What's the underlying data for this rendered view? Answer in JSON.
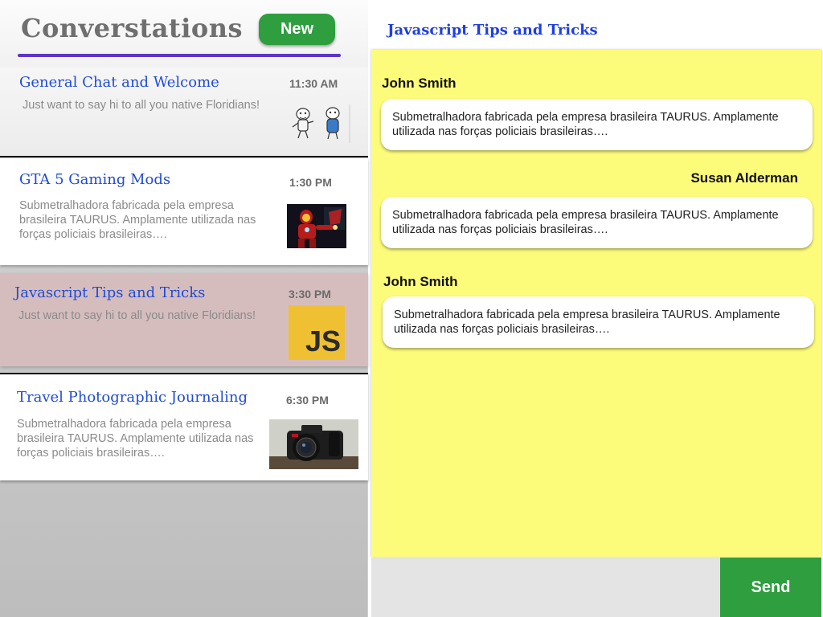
{
  "sidebar": {
    "title": "Converstations",
    "new_button_label": "New",
    "conversations": [
      {
        "title": "General Chat and Welcome",
        "time": "11:30 AM",
        "snippet": "Just want to say hi to all you native Floridians!",
        "thumbnail": "cartoon-characters"
      },
      {
        "title": "GTA 5 Gaming Mods",
        "time": "1:30 PM",
        "snippet": "Submetralhadora fabricada pela empresa brasileira TAURUS. Amplamente utilizada nas forças policiais brasileiras….",
        "thumbnail": "iron-man-game"
      },
      {
        "title": "Javascript Tips and Tricks",
        "time": "3:30 PM",
        "snippet": "Just want to say hi to all you native Floridians!",
        "thumbnail": "js-logo",
        "thumbnail_text": "JS",
        "selected": true
      },
      {
        "title": "Travel Photographic Journaling",
        "time": "6:30 PM",
        "snippet": "Submetralhadora fabricada pela empresa brasileira TAURUS. Amplamente utilizada nas forças policiais brasileiras….",
        "thumbnail": "dslr-camera"
      }
    ]
  },
  "chat": {
    "title": "Javascript Tips and Tricks",
    "messages": [
      {
        "sender": "John Smith",
        "text": "Submetralhadora fabricada pela empresa brasileira TAURUS. Amplamente utilizada nas forças policiais brasileiras….",
        "align": "left"
      },
      {
        "sender": "Susan Alderman",
        "text": "Submetralhadora fabricada pela empresa brasileira TAURUS. Amplamente utilizada nas forças policiais brasileiras….",
        "align": "right"
      },
      {
        "sender": "John Smith",
        "text": "Submetralhadora fabricada pela empresa brasileira TAURUS. Amplamente utilizada nas forças policiais brasileiras….",
        "align": "left"
      }
    ],
    "compose": {
      "value": "",
      "send_label": "Send"
    }
  },
  "colors": {
    "accent_green": "#2e9e3e",
    "title_blue": "#1f4bd6",
    "chat_background": "#fdfb7a",
    "selected_row": "#d6bdbd",
    "underline_purple": "#5b35c9"
  }
}
